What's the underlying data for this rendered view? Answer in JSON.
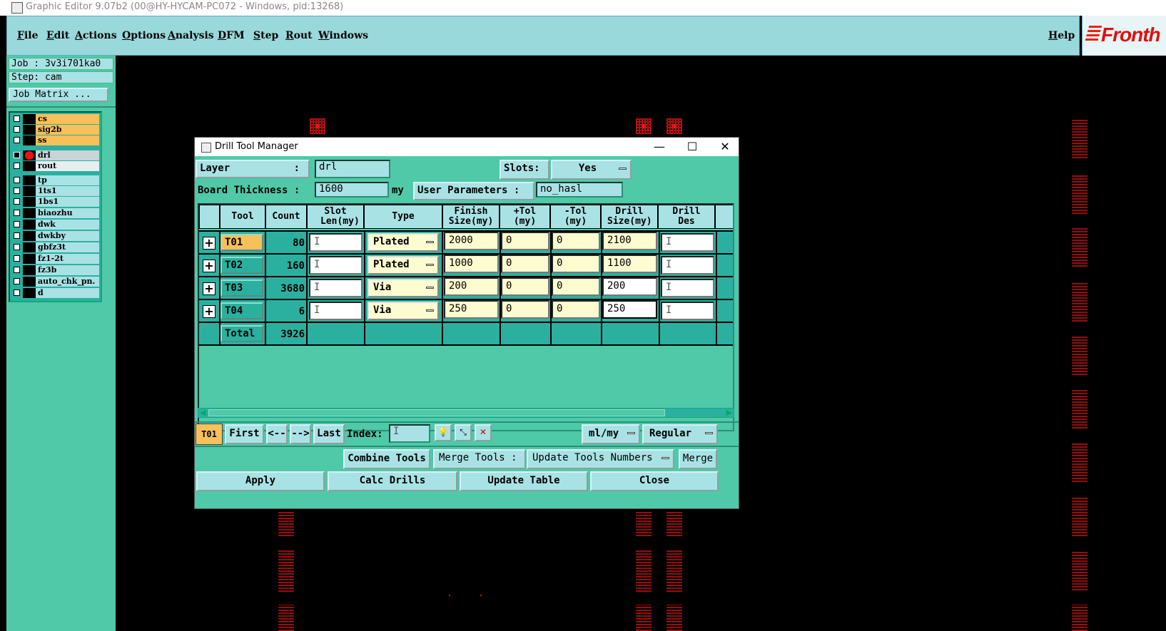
{
  "window": {
    "title": "Graphic Editor 9.07b2 (00@HY-HYCAM-PC072 - Windows, pid:13268)"
  },
  "menu": {
    "items": [
      "File",
      "Edit",
      "Actions",
      "Options",
      "Analysis",
      "DFM",
      "Step",
      "Rout",
      "Windows"
    ],
    "help": "Help",
    "brand": "Fronth"
  },
  "job": {
    "job_label": "Job : 3v3i701ka0",
    "step_label": "Step: cam",
    "matrix_button": "Job Matrix ..."
  },
  "layers": [
    {
      "name": "cs",
      "color": "orange"
    },
    {
      "name": "sig2b",
      "color": "orange"
    },
    {
      "name": "ss",
      "color": "orange"
    },
    {
      "name": "drl",
      "color": "gray",
      "active": true
    },
    {
      "name": "rout",
      "color": "white"
    },
    {
      "name": "tp",
      "color": "teal"
    },
    {
      "name": "1ts1",
      "color": "teal"
    },
    {
      "name": "1bs1",
      "color": "teal"
    },
    {
      "name": "biaozhu",
      "color": "teal"
    },
    {
      "name": "dwk",
      "color": "teal"
    },
    {
      "name": "dwkby",
      "color": "teal"
    },
    {
      "name": "gbfz3t",
      "color": "teal"
    },
    {
      "name": "fz1-2t",
      "color": "teal"
    },
    {
      "name": "fz3b",
      "color": "teal"
    },
    {
      "name": "auto_chk_pn.",
      "color": "teal"
    },
    {
      "name": "d",
      "color": "teal"
    }
  ],
  "dialog": {
    "title": "Drill Tool Manager",
    "window_buttons": {
      "minimize": "—",
      "maximize": "☐",
      "close": "✕"
    },
    "layer_label": "Layer",
    "layer_value": "drl",
    "slots_label": "Slots:",
    "slots_value": "Yes",
    "board_thickness_label": "Board Thickness :",
    "board_thickness_value": "1600",
    "board_thickness_unit": "my",
    "user_params_label": "User Parameters :",
    "user_params_value": "no_hasl",
    "columns": [
      "Tool",
      "Count",
      "Slot Len(my)",
      "Type",
      "Finish Size(my)",
      "+Tol (my)",
      "-Tol (my)",
      "Drill Size(my)",
      "Drill Des"
    ],
    "rows": [
      {
        "tool": "T01",
        "count": "80",
        "slot": "",
        "type": "Plated",
        "finish": "2000",
        "ptol": "0",
        "mtol": "0",
        "drill": "2100",
        "des": ""
      },
      {
        "tool": "T02",
        "count": "160",
        "slot": "",
        "type": "Plated",
        "finish": "1000",
        "ptol": "0",
        "mtol": "0",
        "drill": "1100",
        "des": ""
      },
      {
        "tool": "T03",
        "count": "3680",
        "slot": "",
        "type": "Via",
        "finish": "200",
        "ptol": "0",
        "mtol": "0",
        "drill": "200",
        "des": ""
      },
      {
        "tool": "T04",
        "count": "6",
        "slot": "",
        "type": "Via",
        "finish": "250",
        "ptol": "0",
        "mtol": "0",
        "drill": "250",
        "des": ""
      }
    ],
    "total_label": "Total",
    "total_count": "3926",
    "nav": {
      "current_tool": "T01",
      "first": "First",
      "prev": "<--",
      "next": "-->",
      "last": "Last",
      "index_label": "Index:",
      "index_value": "",
      "units": "ml/my",
      "mode": "Regular"
    },
    "combine_tools": "Combine Tools",
    "merge_tools_label": "Merge Tools :",
    "merge_mode": "Update Tools Numbers",
    "merge": "Merge",
    "apply": "Apply",
    "calc_drills": "Calc Drills",
    "update_table": "Update Table",
    "close": "Close"
  }
}
